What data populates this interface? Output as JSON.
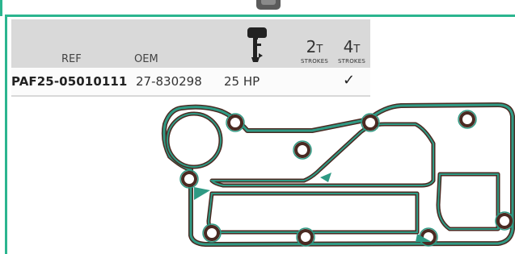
{
  "header": {
    "ref_label": "REF",
    "oem_label": "OEM",
    "motor_icon": "outboard-motor-icon",
    "stroke_2t": {
      "number": "2",
      "unit": "T",
      "label": "STROKES"
    },
    "stroke_4t": {
      "number": "4",
      "unit": "T",
      "label": "STROKES"
    }
  },
  "rows": [
    {
      "ref": "PAF25-05010111",
      "oem": "27-830298",
      "hp": "25 HP",
      "two_stroke": "",
      "four_stroke": "✓"
    }
  ],
  "colors": {
    "accent_border": "#2bb58f",
    "header_bg": "#d9d9d9",
    "gasket_fill": "#2f9a84",
    "gasket_edge": "#4a2a22"
  }
}
